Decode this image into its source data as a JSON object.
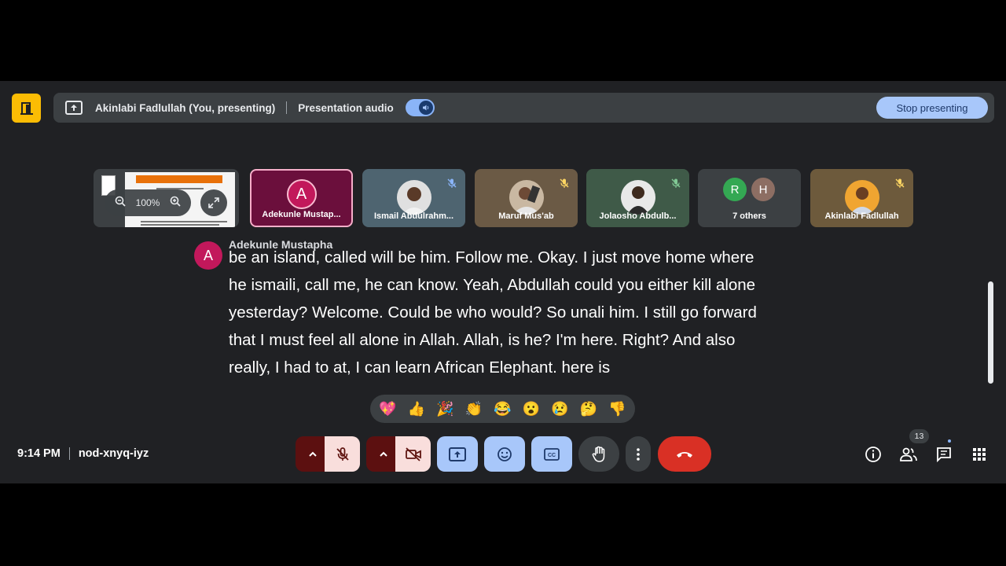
{
  "presenting_bar": {
    "presenter_label": "Akinlabi Fadlullah (You, presenting)",
    "audio_label": "Presentation audio",
    "audio_enabled": true,
    "stop_button": "Stop presenting"
  },
  "slide_preview": {
    "zoom_level": "100%"
  },
  "tiles": [
    {
      "name": "Adekunle Mustap...",
      "initial": "A",
      "active_speaker": true
    },
    {
      "name": "Ismail Abdulrahm...",
      "muted": true
    },
    {
      "name": "Maruf Mus'ab",
      "muted": true
    },
    {
      "name": "Jolaosho Abdulb...",
      "muted": true
    },
    {
      "name": "7 others",
      "avatars": [
        "R",
        "H"
      ]
    },
    {
      "name": "Akinlabi Fadlullah",
      "muted": true
    }
  ],
  "caption": {
    "speaker_initial": "A",
    "speaker": "Adekunle Mustapha",
    "lines": [
      "be an island, called will be him. Follow me. Okay. I just move home where",
      "he ismaili, call me, he can know. Yeah, Abdullah could you either kill alone",
      "yesterday? Welcome. Could be who would? So unali him. I still go forward",
      "that I must feel all alone in Allah. Allah, is he? I'm here. Right? And also",
      "really, I had to at, I can learn African Elephant. here is"
    ]
  },
  "reactions": [
    "💖",
    "👍",
    "🎉",
    "👏",
    "😂",
    "😮",
    "😢",
    "🤔",
    "👎"
  ],
  "footer": {
    "time": "9:14 PM",
    "meeting_code": "nod-xnyq-iyz",
    "people_count": "13"
  },
  "colors": {
    "background": "#202124",
    "accent_blue": "#a8c7fa",
    "end_call_red": "#d93025",
    "speaker_pink": "#c2185b",
    "meet_yellow": "#fbbc04"
  }
}
